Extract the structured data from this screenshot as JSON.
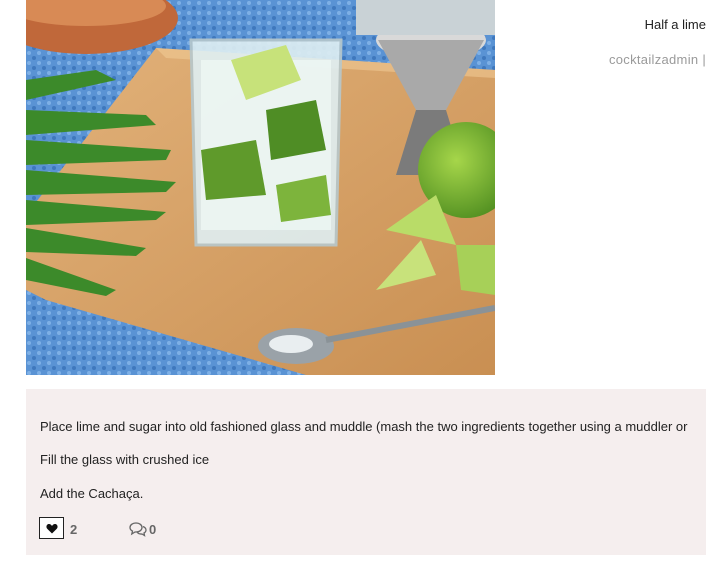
{
  "sidebar": {
    "ingredient_text": "Half a lime",
    "author": "cocktailzadmin |"
  },
  "post": {
    "image_alt": "Caipirinha cocktail with lime on a wooden board",
    "steps": [
      "Place lime and sugar into old fashioned glass and muddle (mash the two ingredients together using a muddler or",
      "Fill the glass with crushed ice",
      "Add the Cachaça."
    ],
    "likes": "2",
    "comments": "0"
  },
  "icons": {
    "like": "heart-icon",
    "comment": "comment-bubble-icon"
  },
  "colors": {
    "panel_bg": "#f5eeee",
    "author_text": "#9a9a9a",
    "count_text": "#666666"
  }
}
